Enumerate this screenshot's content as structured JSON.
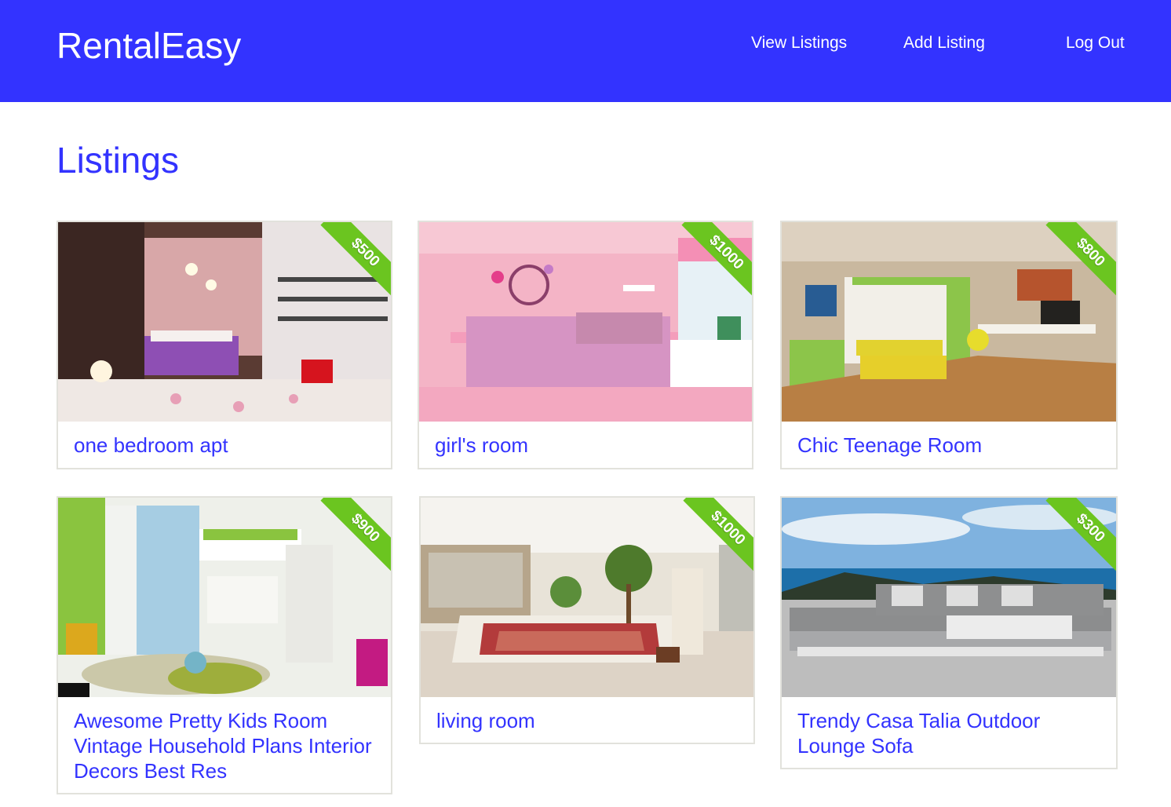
{
  "header": {
    "brand": "RentalEasy",
    "nav": {
      "view_listings": "View Listings",
      "add_listing": "Add Listing",
      "log_out": "Log Out"
    }
  },
  "main": {
    "title": "Listings",
    "listings": [
      {
        "title": "one bedroom apt",
        "price": "$500"
      },
      {
        "title": "girl's room",
        "price": "$1000"
      },
      {
        "title": "Chic Teenage Room",
        "price": "$800"
      },
      {
        "title": "Awesome Pretty Kids Room Vintage Household Plans Interior Decors Best Res",
        "price": "$900"
      },
      {
        "title": "living room",
        "price": "$1000"
      },
      {
        "title": "Trendy Casa Talia Outdoor Lounge Sofa",
        "price": "$300"
      }
    ]
  },
  "colors": {
    "accent": "#3333ff",
    "price_ribbon": "#6bc520",
    "card_border": "#e2e2dc"
  }
}
